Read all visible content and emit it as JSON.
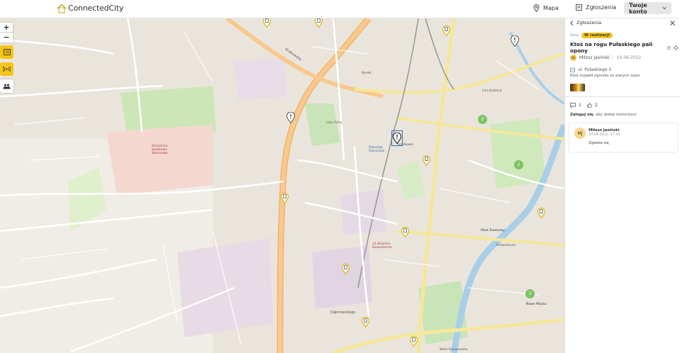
{
  "app": {
    "logo_text": "ConnectedCity"
  },
  "nav": {
    "map_label": "Mapa",
    "reports_label": "Zgłoszenia",
    "account_label": "Twoje konto"
  },
  "map": {
    "zoom_in": "+",
    "zoom_out": "−",
    "labels": [
      {
        "text": "Krakowska"
      },
      {
        "text": "Lisa Kuźnica"
      },
      {
        "text": "Rynek"
      },
      {
        "text": "Rzeszów Staroniwa"
      },
      {
        "text": "Szadkowa"
      },
      {
        "text": "21 Batalion Dowodzenia"
      },
      {
        "text": "Most Zamkowy"
      },
      {
        "text": "Nowe Miasto"
      },
      {
        "text": "Dąbrowskiego"
      },
      {
        "text": "Wola Rzeszowska"
      },
      {
        "text": "Strzelnica wojskowa Staroniwa"
      },
      {
        "text": "Podwisłocze"
      },
      {
        "text": "Lisia Góra"
      }
    ],
    "clusters": [
      {
        "count": "2"
      },
      {
        "count": "2"
      },
      {
        "count": "2"
      }
    ]
  },
  "panel": {
    "back_label": "Zgłoszenia",
    "category": "Inny",
    "status_badge": "W realizacji",
    "title": "Ktoś na rogu Pułaskiego pali opony",
    "author_initials": "MJ",
    "author_name": "Miłosz Jasiński",
    "date": "10.06.2022",
    "address": "ul. Pułaskiego 5",
    "description": "Ktoś rozpalił ognisko ze starych opon",
    "comments_count": "1",
    "likes_count": "2",
    "login_link": "Zaloguj się",
    "login_suffix": ", aby dodać komentarz",
    "comment": {
      "initials": "MJ",
      "author": "Miłosz Jasiński",
      "timestamp": "10.06.2022, 17:29",
      "text": "Zgadza się"
    }
  },
  "colors": {
    "accent": "#f5c518",
    "badge": "#f5c518",
    "cluster": "#7cc464",
    "pin_alert": "#555555"
  }
}
